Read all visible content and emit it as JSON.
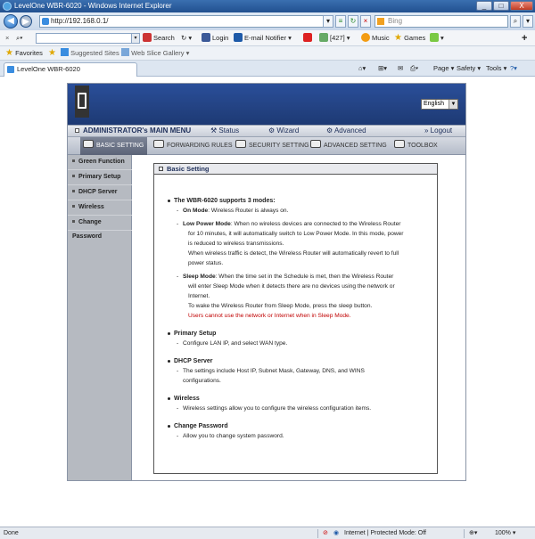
{
  "window": {
    "title": "LevelOne WBR-6020 - Windows Internet Explorer",
    "min": "_",
    "max": "□",
    "close": "X"
  },
  "address": {
    "url": "http://192.168.0.1/",
    "search_placeholder": "Bing"
  },
  "toolbar": {
    "search_label": "Search",
    "login_label": "Login",
    "email_label": "E-mail Notifier",
    "count_label": "[427]",
    "music_label": "Music",
    "games_label": "Games"
  },
  "favorites": {
    "favorites_label": "Favorites",
    "suggested_label": "Suggested Sites",
    "webslice_label": "Web Slice Gallery"
  },
  "tab": {
    "label": "LevelOne WBR-6020"
  },
  "commands": {
    "page": "Page",
    "safety": "Safety",
    "tools": "Tools"
  },
  "router": {
    "language": "English",
    "main_menu": {
      "title": "ADMINISTRATOR's MAIN MENU",
      "status": "Status",
      "wizard": "Wizard",
      "advanced": "Advanced",
      "logout": "Logout"
    },
    "submenu": {
      "basic": "BASIC SETTING",
      "forwarding": "FORWARDING RULES",
      "security": "SECURITY SETTING",
      "advanced": "ADVANCED SETTING",
      "toolbox": "TOOLBOX"
    },
    "left_nav": [
      "Green Function",
      "Primary Setup",
      "DHCP Server",
      "Wireless",
      "Change Password"
    ],
    "content": {
      "header": "Basic Setting",
      "intro": "The WBR-6020 supports 3 modes:",
      "on_mode_title": "On Mode",
      "on_mode_text": ": Wireless Router is always on.",
      "low_title": "Low Power Mode",
      "low_line1": ": When no wireless devices are connected to the Wireless Router",
      "low_line2": "for 10 minutes, it will automatically switch to Low Power Mode. In this mode, power",
      "low_line3": "is reduced to wireless transmissions.",
      "low_line4": "When wireless traffic is detect, the Wireless Router will automatically revert to full",
      "low_line5": "power status.",
      "sleep_title": "Sleep Mode",
      "sleep_line1": ": When the time set in the Schedule is met, then the Wireless Router",
      "sleep_line2": "will enter Sleep Mode when it detects there are no devices using the network or",
      "sleep_line3": "Internet.",
      "sleep_line4": "To wake the Wireless Router from Sleep Mode, press the sleep button.",
      "sleep_warning": "Users cannot use the network or Internet when in Sleep Mode.",
      "primary_title": "Primary Setup",
      "primary_text": "Configure LAN IP, and select WAN type.",
      "dhcp_title": "DHCP Server",
      "dhcp_line1": "The settings include Host IP, Subnet Mask, Gateway, DNS, and WINS",
      "dhcp_line2": "configurations.",
      "wireless_title": "Wireless",
      "wireless_text": "Wireless settings allow you to configure the wireless configuration items.",
      "password_title": "Change Password",
      "password_text": "Allow you to change system password."
    }
  },
  "status": {
    "left": "Done",
    "zone": "Internet | Protected Mode: Off",
    "zoom": "100%"
  }
}
